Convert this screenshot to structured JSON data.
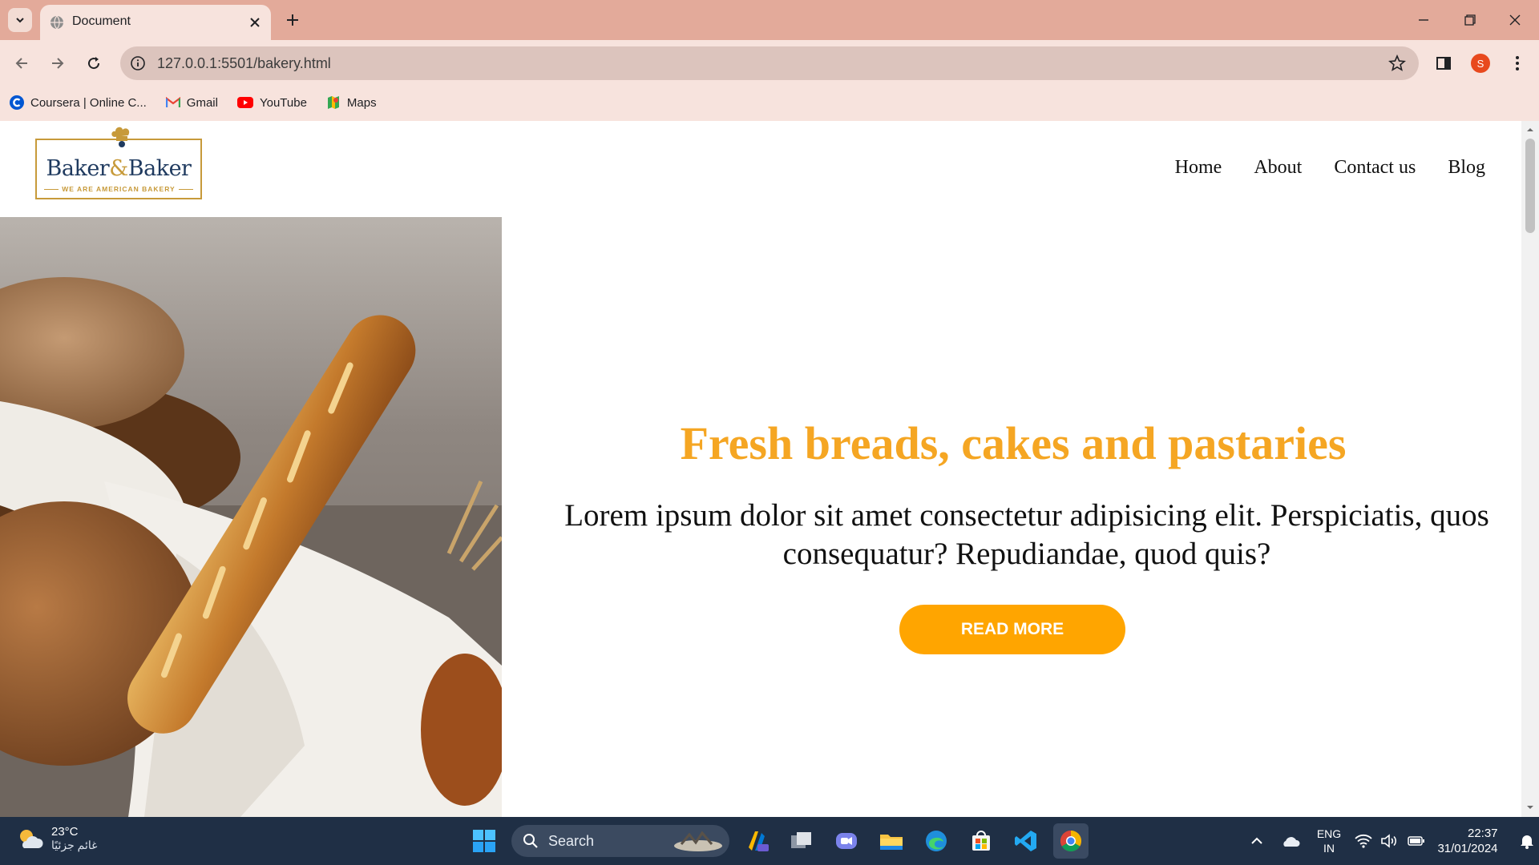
{
  "browser": {
    "tab_title": "Document",
    "url": "127.0.0.1:5501/bakery.html",
    "profile_initial": "S",
    "bookmarks": [
      {
        "label": "Coursera | Online C...",
        "icon": "coursera-icon"
      },
      {
        "label": "Gmail",
        "icon": "gmail-icon"
      },
      {
        "label": "YouTube",
        "icon": "youtube-icon"
      },
      {
        "label": "Maps",
        "icon": "maps-icon"
      }
    ]
  },
  "site": {
    "logo": {
      "name_left": "Baker",
      "name_amp": "&",
      "name_right": "Baker",
      "tagline": "WE ARE AMERICAN BAKERY"
    },
    "nav": [
      "Home",
      "About",
      "Contact us",
      "Blog"
    ],
    "hero": {
      "headline": "Fresh breads, cakes and pastaries",
      "text": "Lorem ipsum dolor sit amet consectetur adipisicing elit. Perspiciatis, quos consequatur? Repudiandae, quod quis?",
      "button": "READ MORE"
    },
    "colors": {
      "accent": "#ffa500",
      "headline": "#f5a623"
    }
  },
  "taskbar": {
    "weather_temp": "23°C",
    "weather_desc": "غائم جزئيًا",
    "search_label": "Search",
    "lang_top": "ENG",
    "lang_bottom": "IN",
    "time": "22:37",
    "date": "31/01/2024"
  }
}
